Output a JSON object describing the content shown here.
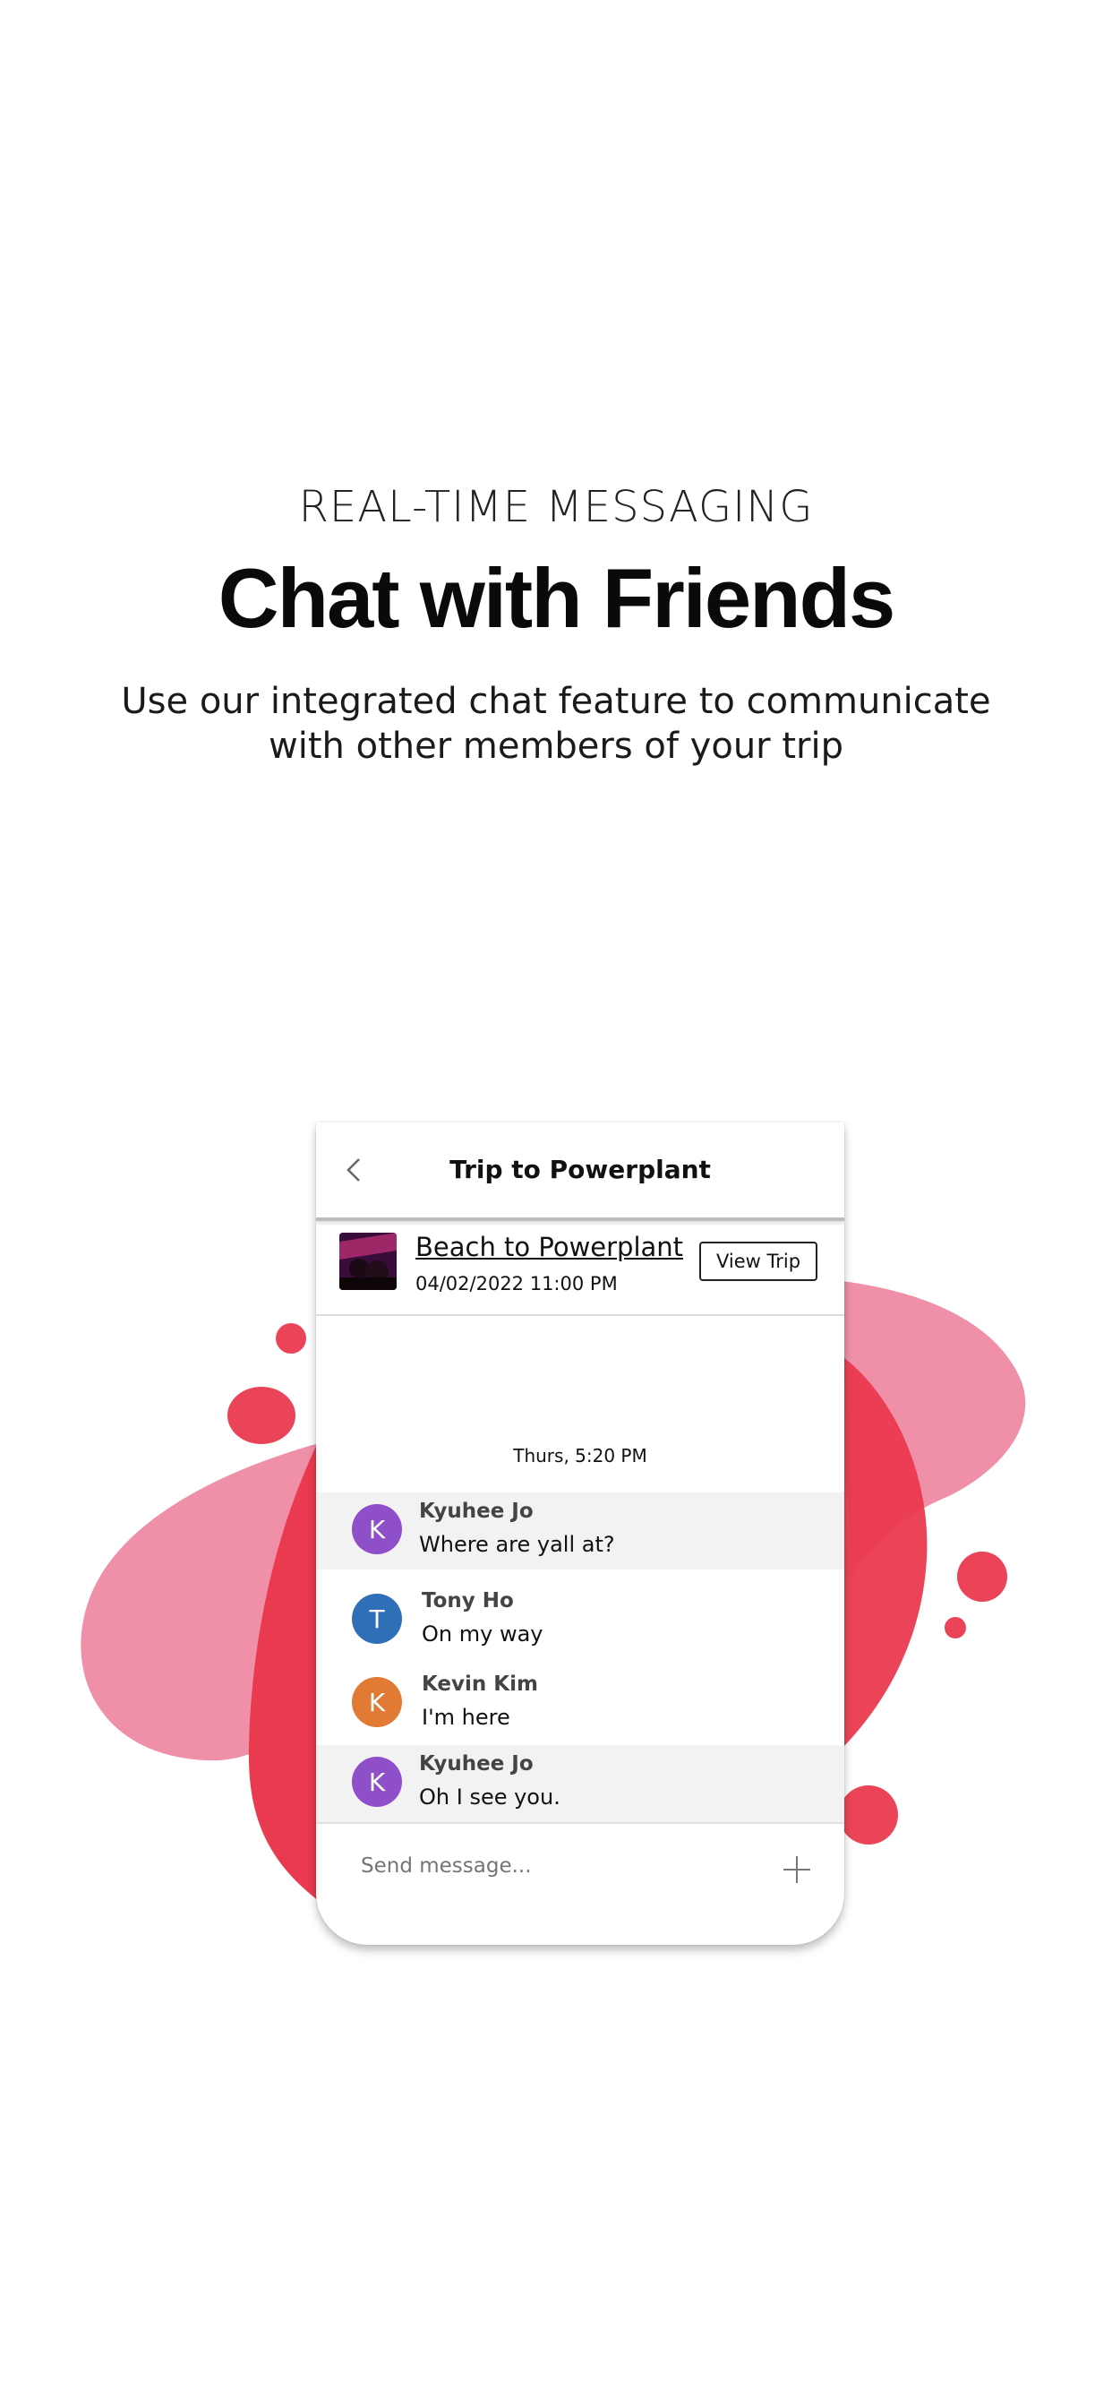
{
  "hero": {
    "eyebrow": "REAL-TIME MESSAGING",
    "title": "Chat with Friends",
    "subtitle": "Use our integrated chat feature to communicate with other members of your trip"
  },
  "chat": {
    "header_title": "Trip to Powerplant",
    "trip_card": {
      "name": "Beach to Powerplant",
      "datetime": "04/02/2022 11:00 PM",
      "button_label": "View Trip"
    },
    "timestamp": "Thurs, 5:20 PM",
    "messages": [
      {
        "initial": "K",
        "sender": "Kyuhee Jo",
        "text": "Where are yall at?",
        "avatar_color": "#8e4fc8"
      },
      {
        "initial": "T",
        "sender": "Tony Ho",
        "text": "On my way",
        "avatar_color": "#2f6fb7"
      },
      {
        "initial": "K",
        "sender": "Kevin Kim",
        "text": "I'm here",
        "avatar_color": "#e07a35"
      },
      {
        "initial": "K",
        "sender": "Kyuhee Jo",
        "text": "Oh I see you.",
        "avatar_color": "#8e4fc8"
      }
    ],
    "composer": {
      "placeholder": "Send message..."
    }
  },
  "colors": {
    "blob_pink": "#ee8aa3",
    "blob_red": "#ea3a4f"
  }
}
